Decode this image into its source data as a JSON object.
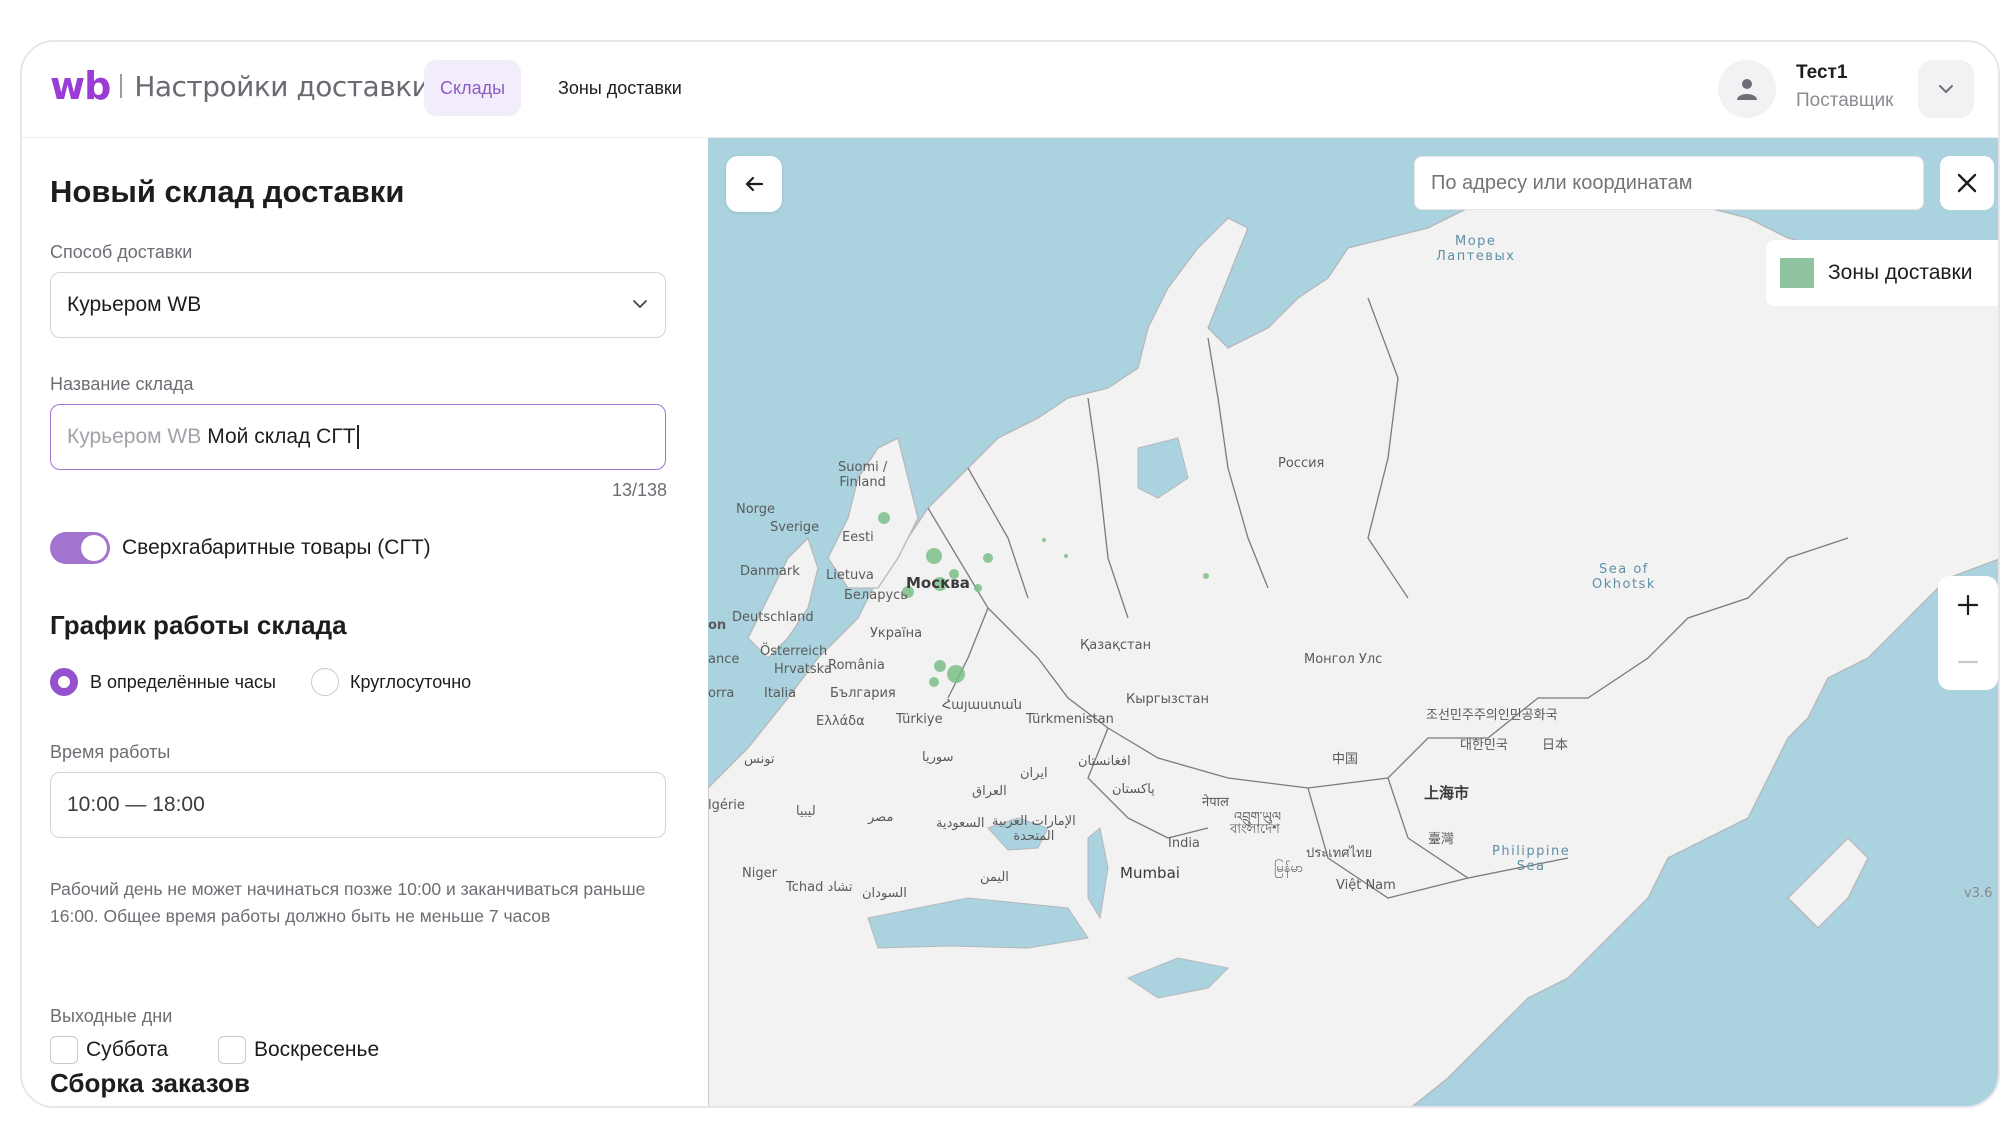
{
  "header": {
    "logo": "wb",
    "title": "Настройки доставки",
    "tabs": [
      {
        "label": "Склады",
        "active": true
      },
      {
        "label": "Зоны доставки",
        "active": false
      }
    ],
    "user": {
      "name": "Тест1",
      "role": "Поставщик"
    }
  },
  "form": {
    "title": "Новый склад доставки",
    "delivery_method": {
      "label": "Способ доставки",
      "value": "Курьером WB"
    },
    "warehouse_name": {
      "label": "Название склада",
      "prefix": "Курьером WB",
      "value": "Мой склад СГТ",
      "counter": "13/138"
    },
    "oversize": {
      "label": "Сверхгабаритные товары (СГТ)",
      "enabled": true
    },
    "schedule": {
      "title": "График работы склада",
      "options": [
        {
          "label": "В определённые часы",
          "checked": true
        },
        {
          "label": "Круглосуточно",
          "checked": false
        }
      ],
      "hours_label": "Время работы",
      "hours_value": "10:00 — 18:00",
      "hint": "Рабочий день не может начинаться позже 10:00 и заканчиваться раньше 16:00. Общее время работы должно быть не меньше 7 часов"
    },
    "days_off": {
      "label": "Выходные дни",
      "options": [
        {
          "label": "Суббота",
          "checked": false
        },
        {
          "label": "Воскресенье",
          "checked": false
        }
      ]
    },
    "orders_section_title": "Сборка заказов"
  },
  "map": {
    "search_placeholder": "По адресу или координатам",
    "legend_label": "Зоны доставки",
    "legend_color": "#8fc29e",
    "water_color": "#aad3df",
    "land_color": "#f2f2f2",
    "labels": {
      "sea_laptev": "Море\nЛаптевых",
      "russia": "Россия",
      "finland": "Suomi /\nFinland",
      "norway": "Norge",
      "sweden": "Sverige",
      "estonia": "Eesti",
      "denmark": "Danmark",
      "lithuania": "Lietuva",
      "moscow": "Москва",
      "belarus": "Беларусь",
      "germany": "Deutschland",
      "ukraine": "Україна",
      "kazakhstan": "Қазақстан",
      "mongolia": "Монгол Улс",
      "austria": "Österreich",
      "croatia": "Hrvatska",
      "romania": "România",
      "italy": "Italia",
      "bulgaria": "България",
      "greece": "Ελλάδα",
      "turkey": "Türkiye",
      "turkmenistan": "Türkmenistan",
      "kyrgyzstan": "Кыргызстан",
      "north_korea": "조선민주주의인민공화국",
      "korea": "대한민국",
      "japan": "日本",
      "china": "中国",
      "shanghai": "上海市",
      "taiwan": "臺灣",
      "iran": "ایران",
      "afghanistan": "افغانستان",
      "pakistan": "پاکستان",
      "nepal": "नेपाल",
      "bhutan": "འབྲུག་ཡུལ",
      "bangladesh": "বাংলাদেশ",
      "india": "India",
      "mumbai": "Mumbai",
      "myanmar": "မြန်မာ",
      "thailand": "ประเทศไทย",
      "vietnam": "Việt Nam",
      "philippine_sea": "Philippine\nSea",
      "okhotsk": "Sea of\nOkhotsk",
      "niger": "Niger",
      "chad": "Tchad تشاد",
      "algeria": "lgérie",
      "libya": "ليبيا",
      "egypt": "مصر",
      "saudi": "السعودية",
      "uae": "الإمارات العربية\nالمتحدة",
      "iraq": "العراق",
      "syria": "سوريا",
      "tunisia": "تونس",
      "yemen": "اليمن",
      "sudan": "السودان",
      "armenia": "Հայաստան",
      "france_partial": "ance",
      "on_partial": "on",
      "morocco_partial": "orra",
      "version": "v3.6"
    }
  }
}
